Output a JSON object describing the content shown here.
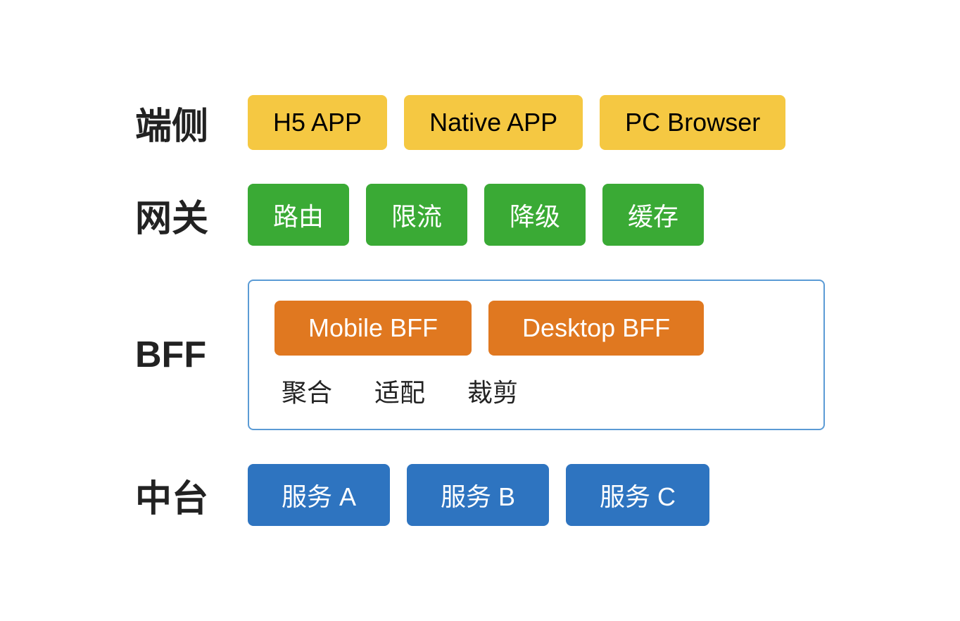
{
  "tiers": [
    {
      "id": "duance",
      "label": "端侧",
      "type": "orange",
      "items": [
        "H5 APP",
        "Native APP",
        "PC Browser"
      ]
    },
    {
      "id": "wanguan",
      "label": "网关",
      "type": "green",
      "items": [
        "路由",
        "限流",
        "降级",
        "缓存"
      ]
    },
    {
      "id": "bff",
      "label": "BFF",
      "type": "bff",
      "bff_items": [
        "Mobile BFF",
        "Desktop BFF"
      ],
      "bff_bottom": [
        "聚合",
        "适配",
        "裁剪"
      ]
    },
    {
      "id": "zhongtai",
      "label": "中台",
      "type": "blue",
      "items": [
        "服务 A",
        "服务 B",
        "服务 C"
      ]
    }
  ]
}
